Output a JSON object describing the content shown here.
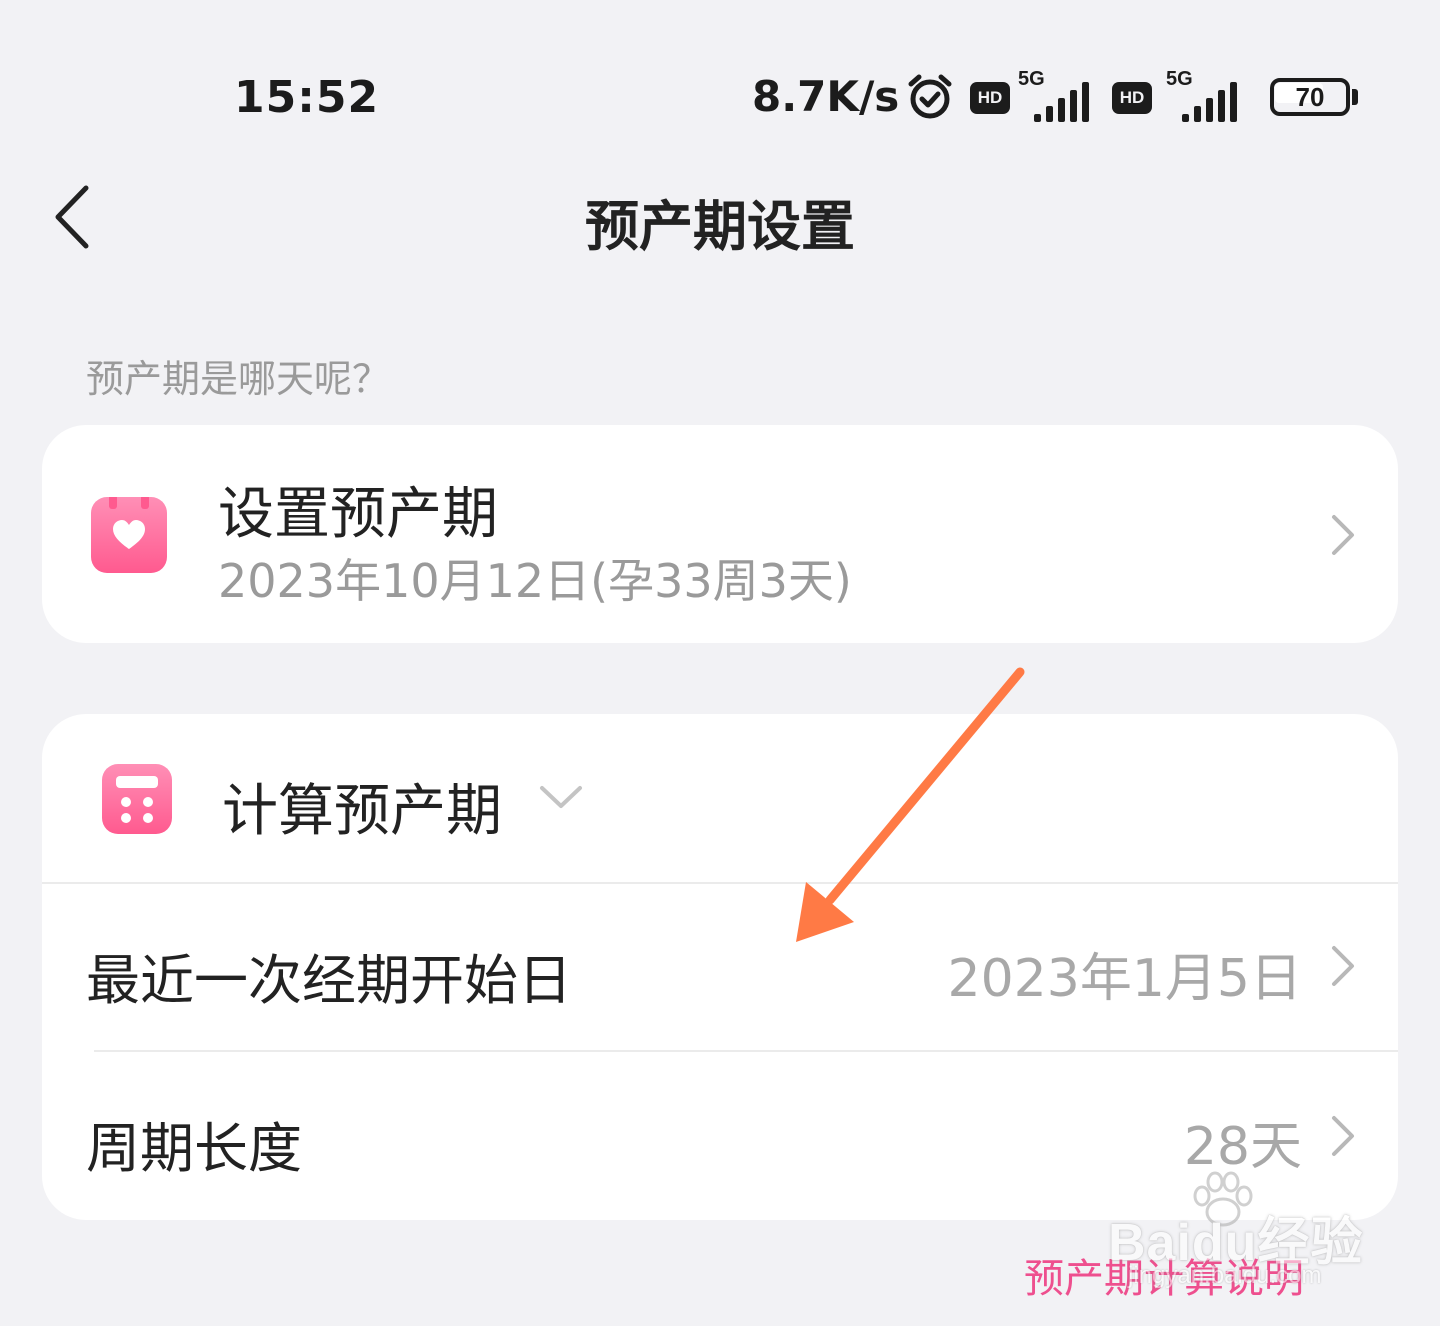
{
  "status_bar": {
    "time": "15:52",
    "net_speed": "8.7K/s",
    "hd_label": "HD",
    "signal_label": "5G",
    "battery_level": "70"
  },
  "nav": {
    "title": "预产期设置"
  },
  "section_hint": "预产期是哪天呢？",
  "due_date_card": {
    "title": "设置预产期",
    "subtitle": "2023年10月12日(孕33周3天)"
  },
  "calc_card": {
    "header": "计算预产期",
    "rows": [
      {
        "label": "最近一次经期开始日",
        "value": "2023年1月5日"
      },
      {
        "label": "周期长度",
        "value": "28天"
      }
    ]
  },
  "footer": {
    "explain_link": "预产期计算说明"
  },
  "watermark": {
    "brand": "Baidu经验",
    "url": "jingyan.baidu.com"
  },
  "colors": {
    "accent_pink": "#ff5a8f",
    "link_pink": "#ee4f8e",
    "annotation_arrow": "#ff7a45"
  }
}
